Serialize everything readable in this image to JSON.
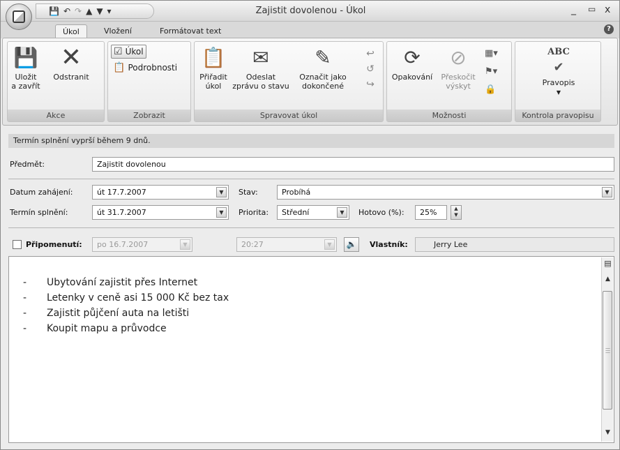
{
  "window": {
    "title": "Zajistit dovolenou - Úkol",
    "controls": {
      "minimize": "_",
      "maximize": "▭",
      "close": "x"
    }
  },
  "qat": {
    "save_icon": "save-icon",
    "undo_icon": "undo-icon",
    "redo_icon": "redo-icon",
    "up_icon": "arrow-up-icon",
    "down_icon": "arrow-down-icon",
    "customize": "▾"
  },
  "tabs": [
    {
      "label": "Úkol",
      "active": true
    },
    {
      "label": "Vložení",
      "active": false
    },
    {
      "label": "Formátovat text",
      "active": false
    }
  ],
  "ribbon": {
    "groups": {
      "akce": {
        "label": "Akce",
        "save_close": [
          "Uložit",
          "a zavřít"
        ],
        "delete": "Odstranit"
      },
      "zobrazit": {
        "label": "Zobrazit",
        "task": "Úkol",
        "details": "Podrobnosti"
      },
      "spravovat": {
        "label": "Spravovat úkol",
        "assign": [
          "Přiřadit",
          "úkol"
        ],
        "send_status": [
          "Odeslat",
          "zprávu o stavu"
        ],
        "mark_complete": [
          "Označit jako",
          "dokončené"
        ]
      },
      "moznosti": {
        "label": "Možnosti",
        "recurrence": "Opakování",
        "skip": [
          "Přeskočit",
          "výskyt"
        ]
      },
      "kontrola": {
        "label": "Kontrola pravopisu",
        "spelling": "Pravopis",
        "abc": "ABC"
      }
    }
  },
  "form": {
    "notice": "Termín splnění vyprší během 9 dnů.",
    "subject_label": "Předmět:",
    "subject_value": "Zajistit dovolenou",
    "start_label": "Datum zahájení:",
    "start_value": "út 17.7.2007",
    "due_label": "Termín splnění:",
    "due_value": "út 31.7.2007",
    "status_label": "Stav:",
    "status_value": "Probíhá",
    "priority_label": "Priorita:",
    "priority_value": "Střední",
    "complete_label": "Hotovo (%):",
    "complete_value": "25%",
    "reminder_label": "Připomenutí:",
    "reminder_date": "po 16.7.2007",
    "reminder_time": "20:27",
    "owner_label": "Vlastník:",
    "owner_value": "Jerry Lee"
  },
  "body": {
    "items": [
      "Ubytování zajistit přes Internet",
      "Letenky v ceně asi 15 000 Kč bez tax",
      "Zajistit půjčení auta na letišti",
      "Koupit mapu a průvodce"
    ]
  }
}
